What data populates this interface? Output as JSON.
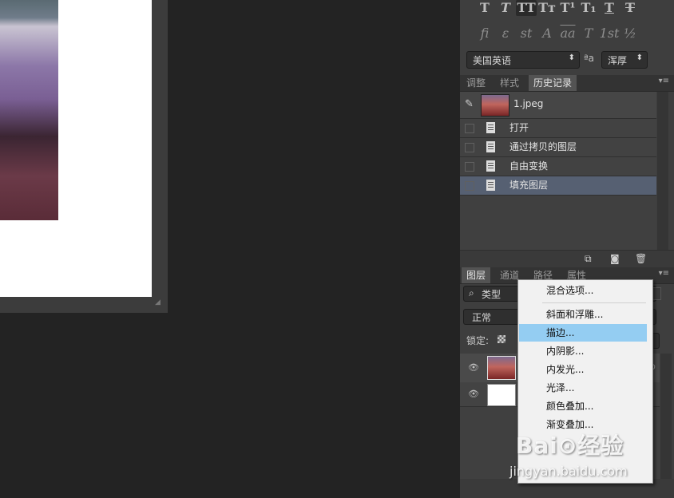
{
  "char_panel": {
    "row1_glyphs": [
      "T",
      "T",
      "TT",
      "Tт",
      "T¹",
      "T₁",
      "T",
      "T"
    ],
    "row2_glyphs": [
      "fi",
      "ɛ",
      "st",
      "A",
      "aa",
      "T",
      "1st",
      "½"
    ],
    "language": "美国英语",
    "aa_label": "ªa",
    "antialias": "浑厚"
  },
  "history_panel": {
    "tabs": [
      "调整",
      "样式",
      "历史记录"
    ],
    "active_tab": "历史记录",
    "snapshot_name": "1.jpeg",
    "items": [
      {
        "label": "打开"
      },
      {
        "label": "通过拷贝的图层"
      },
      {
        "label": "自由变换"
      },
      {
        "label": "填充图层"
      }
    ],
    "selected_item": "填充图层"
  },
  "layers_panel": {
    "tabs": [
      "图层",
      "通道",
      "路径",
      "属性"
    ],
    "active_tab": "图层",
    "filter_kind": "类型",
    "blend_mode": "正常",
    "lock_label": "锁定:"
  },
  "context_menu": {
    "items": [
      "混合选项...",
      "斜面和浮雕...",
      "描边...",
      "内阴影...",
      "内发光...",
      "光泽...",
      "颜色叠加...",
      "渐变叠加..."
    ],
    "highlighted": "描边..."
  },
  "watermark": {
    "logo_text": "Bai⊙经验",
    "url": "jingyan.baidu.com"
  }
}
